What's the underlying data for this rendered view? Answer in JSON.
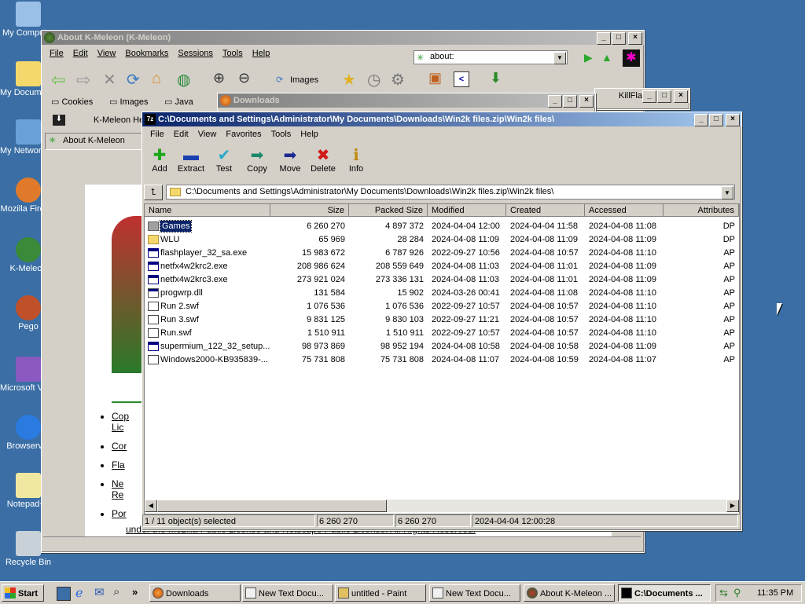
{
  "desktop_icons": [
    {
      "label": "My Computer",
      "icon": "my-computer-icon"
    },
    {
      "label": "My Documents",
      "icon": "my-documents-icon"
    },
    {
      "label": "My Network Places",
      "icon": "network-places-icon"
    },
    {
      "label": "Mozilla Firefox",
      "icon": "firefox-icon"
    },
    {
      "label": "K-Meleon",
      "icon": "kmeleon-icon"
    },
    {
      "label": "Pego",
      "icon": "pego-icon"
    },
    {
      "label": "Microsoft Visual Studio",
      "icon": "visual-studio-icon"
    },
    {
      "label": "Browserver",
      "icon": "ie-icon"
    },
    {
      "label": "Notepad++",
      "icon": "notepad-icon"
    },
    {
      "label": "Recycle Bin",
      "icon": "recycle-bin-icon"
    }
  ],
  "kmeleon": {
    "title": "About K-Meleon (K-Meleon)",
    "menu": [
      "File",
      "Edit",
      "View",
      "Bookmarks",
      "Sessions",
      "Tools",
      "Help"
    ],
    "address": "about:",
    "images_label": "Images",
    "bookmarks": [
      "Cookies",
      "Images",
      "Java"
    ],
    "tabs": [
      "K-Meleon He",
      "About K-Meleon"
    ],
    "page_links": [
      "Cop",
      "Lic",
      "Cor",
      "Fla",
      "Ne",
      "Re",
      "Por"
    ],
    "page_footer": "under the Mozilla Public License and Netscape Public License. All Rights Reserved."
  },
  "downloads": {
    "title": "Downloads"
  },
  "killfla": {
    "title": "KillFla"
  },
  "sevenzip": {
    "title": "C:\\Documents and Settings\\Administrator\\My Documents\\Downloads\\Win2k files.zip\\Win2k files\\",
    "menu": [
      "File",
      "Edit",
      "View",
      "Favorites",
      "Tools",
      "Help"
    ],
    "toolbar": [
      {
        "label": "Add",
        "icon": "plus-icon",
        "color": "#1aa81a"
      },
      {
        "label": "Extract",
        "icon": "minus-icon",
        "color": "#1a3fb0"
      },
      {
        "label": "Test",
        "icon": "check-icon",
        "color": "#2aa8c8"
      },
      {
        "label": "Copy",
        "icon": "arrow-right-icon",
        "color": "#1a8a6a"
      },
      {
        "label": "Move",
        "icon": "arrow-right-icon",
        "color": "#1a2a90"
      },
      {
        "label": "Delete",
        "icon": "x-icon",
        "color": "#d01a1a"
      },
      {
        "label": "Info",
        "icon": "info-icon",
        "color": "#c08a10"
      }
    ],
    "path": "C:\\Documents and Settings\\Administrator\\My Documents\\Downloads\\Win2k files.zip\\Win2k files\\",
    "columns": [
      "Name",
      "Size",
      "Packed Size",
      "Modified",
      "Created",
      "Accessed",
      "Attributes"
    ],
    "rows": [
      {
        "name": "Games",
        "type": "folder-sel",
        "size": "6 260 270",
        "packed": "4 897 372",
        "modified": "2024-04-04 12:00",
        "created": "2024-04-04 11:58",
        "accessed": "2024-04-08 11:08",
        "attr": "DP"
      },
      {
        "name": "WLU",
        "type": "folder",
        "size": "65 969",
        "packed": "28 284",
        "modified": "2024-04-08 11:09",
        "created": "2024-04-08 11:09",
        "accessed": "2024-04-08 11:09",
        "attr": "DP"
      },
      {
        "name": "flashplayer_32_sa.exe",
        "type": "exe",
        "size": "15 983 672",
        "packed": "6 787 926",
        "modified": "2022-09-27 10:56",
        "created": "2024-04-08 10:57",
        "accessed": "2024-04-08 11:10",
        "attr": "AP"
      },
      {
        "name": "netfx4w2krc2.exe",
        "type": "exe",
        "size": "208 986 624",
        "packed": "208 559 649",
        "modified": "2024-04-08 11:03",
        "created": "2024-04-08 11:01",
        "accessed": "2024-04-08 11:09",
        "attr": "AP"
      },
      {
        "name": "netfx4w2krc3.exe",
        "type": "exe",
        "size": "273 921 024",
        "packed": "273 336 131",
        "modified": "2024-04-08 11:03",
        "created": "2024-04-08 11:01",
        "accessed": "2024-04-08 11:09",
        "attr": "AP"
      },
      {
        "name": "progwrp.dll",
        "type": "dll",
        "size": "131 584",
        "packed": "15 902",
        "modified": "2024-03-26 00:41",
        "created": "2024-04-08 11:08",
        "accessed": "2024-04-08 11:10",
        "attr": "AP"
      },
      {
        "name": "Run 2.swf",
        "type": "swf",
        "size": "1 076 536",
        "packed": "1 076 536",
        "modified": "2022-09-27 10:57",
        "created": "2024-04-08 10:57",
        "accessed": "2024-04-08 11:10",
        "attr": "AP"
      },
      {
        "name": "Run 3.swf",
        "type": "swf",
        "size": "9 831 125",
        "packed": "9 830 103",
        "modified": "2022-09-27 11:21",
        "created": "2024-04-08 10:57",
        "accessed": "2024-04-08 11:10",
        "attr": "AP"
      },
      {
        "name": "Run.swf",
        "type": "swf",
        "size": "1 510 911",
        "packed": "1 510 911",
        "modified": "2022-09-27 10:57",
        "created": "2024-04-08 10:57",
        "accessed": "2024-04-08 11:10",
        "attr": "AP"
      },
      {
        "name": "supermium_122_32_setup...",
        "type": "exe",
        "size": "98 973 869",
        "packed": "98 952 194",
        "modified": "2024-04-08 10:58",
        "created": "2024-04-08 10:58",
        "accessed": "2024-04-08 11:09",
        "attr": "AP"
      },
      {
        "name": "Windows2000-KB935839-...",
        "type": "swf",
        "size": "75 731 808",
        "packed": "75 731 808",
        "modified": "2024-04-08 11:07",
        "created": "2024-04-08 10:59",
        "accessed": "2024-04-08 11:07",
        "attr": "AP"
      }
    ],
    "status": {
      "selected": "1 / 11 object(s) selected",
      "size": "6 260 270",
      "packed": "6 260 270",
      "date": "2024-04-04 12:00:28"
    }
  },
  "taskbar": {
    "start": "Start",
    "tasks": [
      {
        "label": "Downloads",
        "icon": "firefox-icon"
      },
      {
        "label": "New Text Docu...",
        "icon": "notepad-icon"
      },
      {
        "label": "untitled - Paint",
        "icon": "paint-icon"
      },
      {
        "label": "New Text Docu...",
        "icon": "notepad-icon"
      },
      {
        "label": "About K-Meleon ...",
        "icon": "kmeleon-icon"
      },
      {
        "label": "C:\\Documents ...",
        "icon": "sevenzip-icon"
      }
    ],
    "clock": "11:35 PM",
    "quick_launch_more": "»"
  },
  "colors": {
    "desktop": "#3a6ea5",
    "active_title": "#0a246a",
    "selection": "#0a246a"
  }
}
